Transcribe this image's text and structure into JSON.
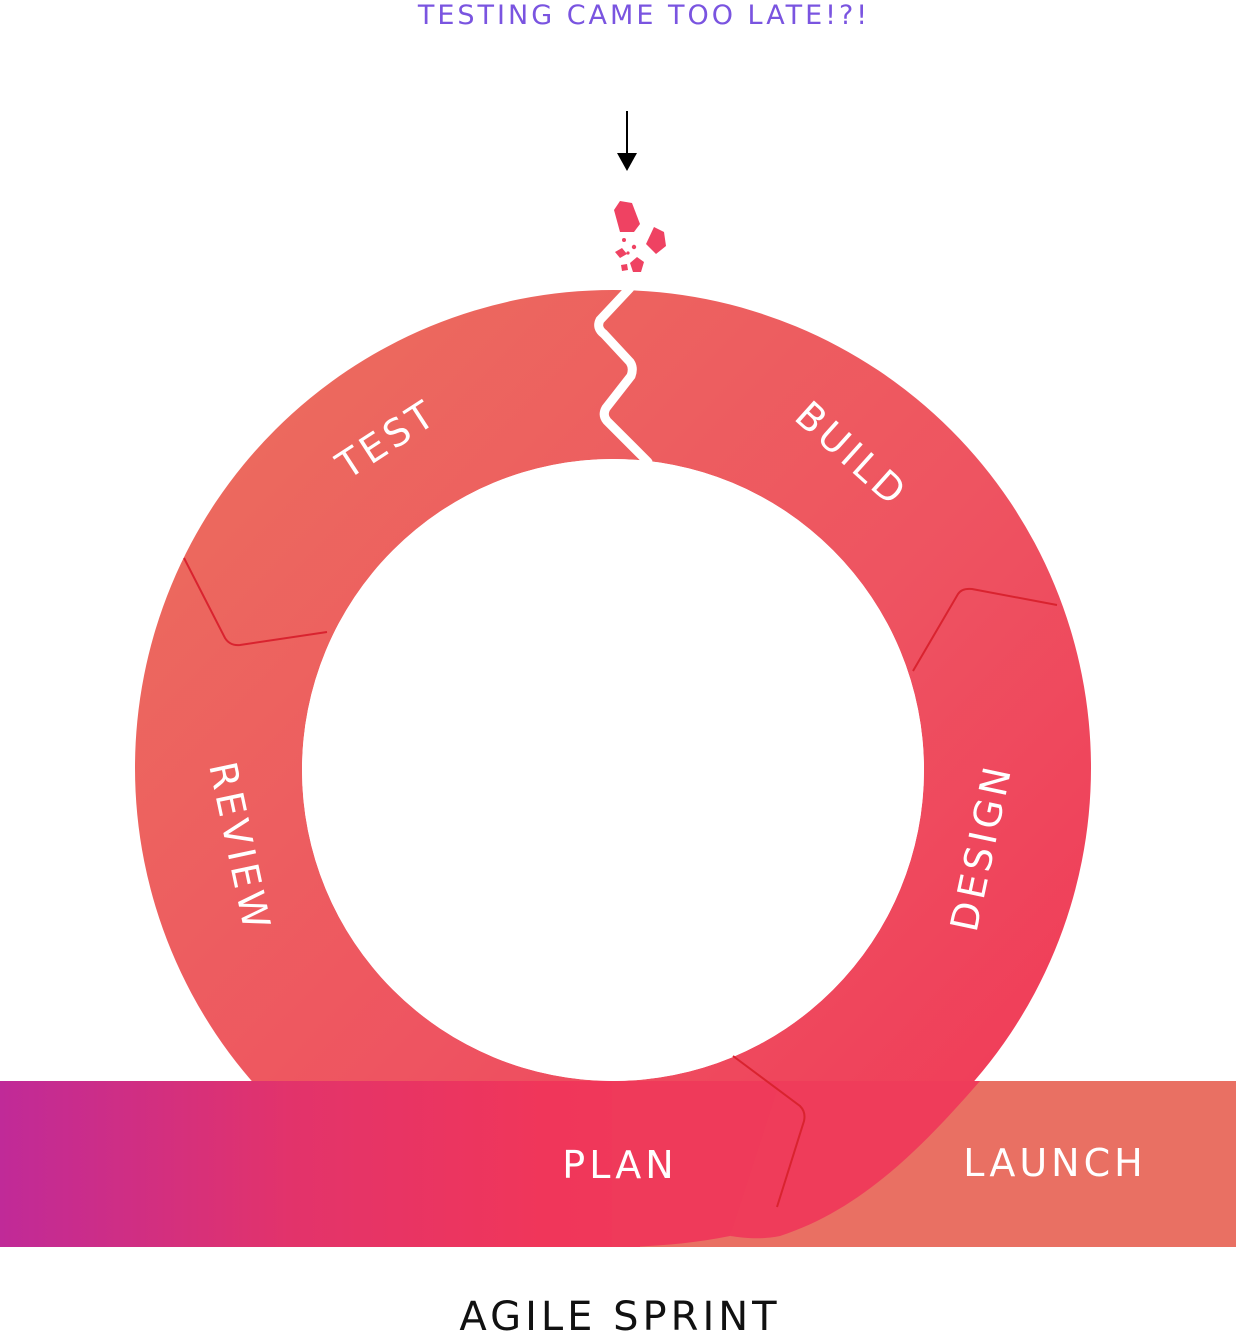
{
  "diagram": {
    "warning_text": "TESTING CAME TOO LATE!?!",
    "caption": "AGILE SPRINT",
    "segments": {
      "test": "TEST",
      "build": "BUILD",
      "design": "DESIGN",
      "review": "REVIEW",
      "plan": "PLAN",
      "launch": "LAUNCH"
    },
    "colors": {
      "ring_light": "#ec6b5e",
      "ring_dark": "#ef3b5c",
      "plan_start": "#c02a98",
      "plan_end": "#f0365a",
      "launch": "#e97063",
      "divider": "#d9232f",
      "fragments": "#ef4262",
      "warning": "#7a54e0",
      "caption": "#111111"
    },
    "icons": {
      "arrow": "down-arrow-icon",
      "crack": "crack-icon",
      "fragments": "broken-pieces-icon"
    }
  }
}
